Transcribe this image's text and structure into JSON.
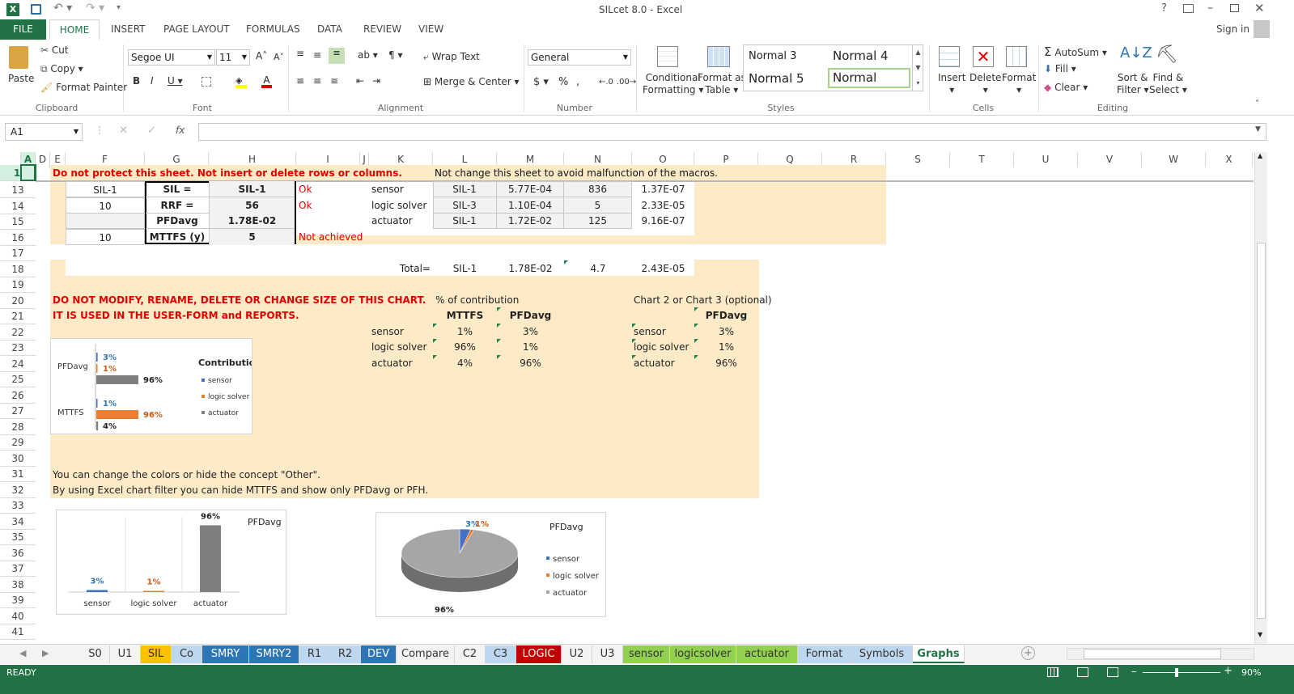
{
  "window": {
    "title": "SILcet 8.0 - Excel",
    "sign_in": "Sign in"
  },
  "ribbon_tabs": [
    "FILE",
    "HOME",
    "INSERT",
    "PAGE LAYOUT",
    "FORMULAS",
    "DATA",
    "REVIEW",
    "VIEW"
  ],
  "clipboard": {
    "paste": "Paste",
    "cut": "Cut",
    "copy": "Copy",
    "format_painter": "Format Painter",
    "label": "Clipboard"
  },
  "font": {
    "name": "Segoe UI",
    "size": "11",
    "label": "Font"
  },
  "alignment": {
    "wrap": "Wrap Text",
    "merge": "Merge & Center",
    "label": "Alignment"
  },
  "number": {
    "format": "General",
    "label": "Number"
  },
  "styles": {
    "conditional_1": "Conditional",
    "conditional_2": "Formatting",
    "format_as_1": "Format as",
    "format_as_2": "Table",
    "normal3": "Normal 3",
    "normal4": "Normal 4",
    "normal5": "Normal 5",
    "normal": "Normal",
    "label": "Styles"
  },
  "cells": {
    "insert": "Insert",
    "delete": "Delete",
    "format": "Format",
    "label": "Cells"
  },
  "editing": {
    "autosum": "AutoSum",
    "fill": "Fill",
    "clear": "Clear",
    "sort_1": "Sort &",
    "sort_2": "Filter",
    "find_1": "Find &",
    "find_2": "Select",
    "label": "Editing"
  },
  "formula_bar": {
    "name_box": "A1",
    "fx": "fx",
    "formula": ""
  },
  "columns": [
    "A",
    "D",
    "E",
    "F",
    "G",
    "H",
    "I",
    "J",
    "K",
    "L",
    "M",
    "N",
    "O",
    "P",
    "Q",
    "R",
    "S",
    "T",
    "U",
    "V",
    "W",
    "X"
  ],
  "rows": [
    "1",
    "13",
    "14",
    "15",
    "16",
    "17",
    "18",
    "19",
    "20",
    "21",
    "22",
    "23",
    "24",
    "25",
    "26",
    "27",
    "28",
    "29",
    "30",
    "31",
    "32",
    "33",
    "34",
    "35",
    "36",
    "37",
    "38",
    "39",
    "40",
    "41"
  ],
  "sheet": {
    "r1_warning": "Do not protect this sheet. Not insert or delete rows or columns.",
    "r1_note": "Not change this sheet to avoid malfunction of the macros.",
    "f13": "SIL-1",
    "g13": "SIL =",
    "h13": "SIL-1",
    "i13": "Ok",
    "f14": "10",
    "g14": "RRF =",
    "h14": "56",
    "i14": "Ok",
    "g15": "PFDavg",
    "h15": "1.78E-02",
    "f16": "10",
    "g16": "MTTFS (y)",
    "h16": "5",
    "i16": "Not achieved",
    "k13": "sensor",
    "k14": "logic solver",
    "k15": "actuator",
    "l13": "SIL-1",
    "l14": "SIL-3",
    "l15": "SIL-1",
    "m13": "5.77E-04",
    "m14": "1.10E-04",
    "m15": "1.72E-02",
    "n13": "836",
    "n14": "5",
    "n15": "125",
    "o13": "1.37E-07",
    "o14": "2.33E-05",
    "o15": "9.16E-07",
    "k18": "Total=",
    "l18": "SIL-1",
    "m18": "1.78E-02",
    "n18": "4.7",
    "o18": "2.43E-05",
    "r20_warn": "DO NOT MODIFY, RENAME, DELETE OR CHANGE SIZE OF THIS CHART.",
    "r21_warn": "IT IS USED IN THE USER-FORM and REPORTS.",
    "pct_title": "% of contribution",
    "mttfs_h": "MTTFS",
    "pfd_h": "PFDavg",
    "contrib_rows": [
      {
        "name": "sensor",
        "mttfs": "1%",
        "pfd": "3%"
      },
      {
        "name": "logic solver",
        "mttfs": "96%",
        "pfd": "1%"
      },
      {
        "name": "actuator",
        "mttfs": "4%",
        "pfd": "96%"
      }
    ],
    "chart23_title": "Chart 2 or Chart 3 (optional)",
    "chart23_h": "PFDavg",
    "chart23_rows": [
      {
        "name": "sensor",
        "pfd": "3%"
      },
      {
        "name": "logic solver",
        "pfd": "1%"
      },
      {
        "name": "actuator",
        "pfd": "96%"
      }
    ],
    "r31": "You can change the colors or hide the concept \"Other\".",
    "r32": "By using Excel chart filter you can hide MTTFS and show only PFDavg or PFH."
  },
  "chart_data": [
    {
      "type": "bar",
      "orientation": "horizontal-stacked",
      "title": "Contribution",
      "categories": [
        "PFDavg",
        "MTTFS"
      ],
      "series": [
        {
          "name": "sensor",
          "values": [
            3,
            1
          ],
          "labels": [
            "3%",
            "1%"
          ]
        },
        {
          "name": "logic solver",
          "values": [
            1,
            96
          ],
          "labels": [
            "1%",
            "96%"
          ]
        },
        {
          "name": "actuator",
          "values": [
            96,
            4
          ],
          "labels": [
            "96%",
            "4%"
          ]
        }
      ],
      "legend": "right"
    },
    {
      "type": "bar",
      "title": "PFDavg",
      "categories": [
        "sensor",
        "logic solver",
        "actuator"
      ],
      "values": [
        3,
        1,
        96
      ],
      "labels": [
        "3%",
        "1%",
        "96%"
      ]
    },
    {
      "type": "pie",
      "title": "PFDavg",
      "categories": [
        "sensor",
        "logic solver",
        "actuator"
      ],
      "values": [
        3,
        1,
        96
      ],
      "labels": [
        "3%",
        "1%",
        "96%"
      ],
      "legend": "right"
    }
  ],
  "colors": {
    "sensor": "#4472c4",
    "logic_solver": "#ed7d31",
    "actuator": "#7f7f7f",
    "peach": "#fdebc8",
    "excel_green": "#217346"
  },
  "sheet_tabs": [
    {
      "name": "S0",
      "bg": ""
    },
    {
      "name": "U1",
      "bg": ""
    },
    {
      "name": "SIL",
      "bg": "#ffc000"
    },
    {
      "name": "Co",
      "bg": "#bdd7ee"
    },
    {
      "name": "SMRY",
      "bg": "#2e75b6"
    },
    {
      "name": "SMRY2",
      "bg": "#2e75b6"
    },
    {
      "name": "R1",
      "bg": "#bdd7ee"
    },
    {
      "name": "R2",
      "bg": "#bdd7ee"
    },
    {
      "name": "DEV",
      "bg": "#2e75b6"
    },
    {
      "name": "Compare",
      "bg": ""
    },
    {
      "name": "C2",
      "bg": ""
    },
    {
      "name": "C3",
      "bg": "#bdd7ee"
    },
    {
      "name": "LOGIC",
      "bg": "#c00000"
    },
    {
      "name": "U2",
      "bg": ""
    },
    {
      "name": "U3",
      "bg": ""
    },
    {
      "name": "sensor",
      "bg": "#92d050"
    },
    {
      "name": "logicsolver",
      "bg": "#92d050"
    },
    {
      "name": "actuator",
      "bg": "#92d050"
    },
    {
      "name": "Format",
      "bg": "#bdd7ee"
    },
    {
      "name": "Symbols",
      "bg": "#bdd7ee"
    },
    {
      "name": "Graphs",
      "bg": "#ffffff"
    }
  ],
  "status": {
    "ready": "READY",
    "zoom": "90%"
  }
}
